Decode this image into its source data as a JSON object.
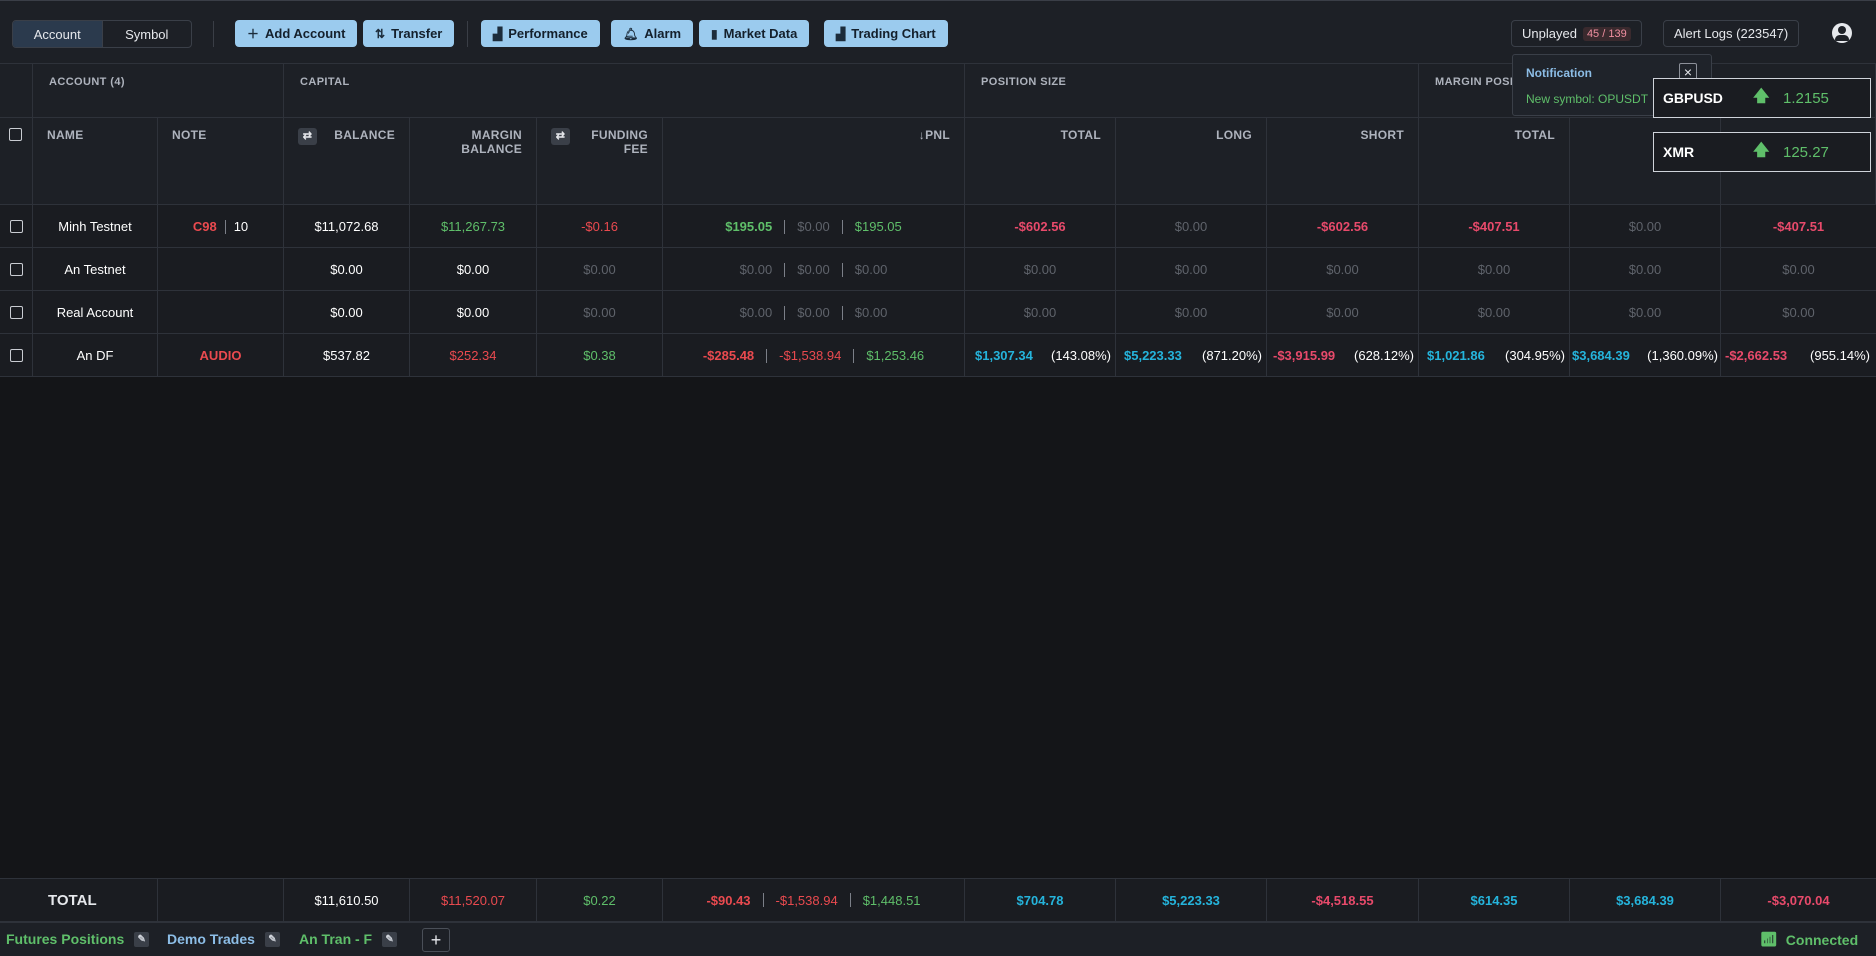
{
  "toolbar": {
    "view_tabs": [
      "Account",
      "Symbol"
    ],
    "add_account": "Add Account",
    "transfer": "Transfer",
    "performance": "Performance",
    "alarm": "Alarm",
    "market_data": "Market Data",
    "trading_chart": "Trading Chart",
    "unplayed_label": "Unplayed",
    "unplayed_count": "45 / 139",
    "alert_logs": "Alert Logs (223547)"
  },
  "groups": {
    "account": "ACCOUNT (4)",
    "capital": "CAPITAL",
    "position_size": "POSITION SIZE",
    "margin_pos": "MARGIN POSI"
  },
  "columns": {
    "name": "NAME",
    "note": "NOTE",
    "balance": "BALANCE",
    "margin_balance_1": "MARGIN",
    "margin_balance_2": "BALANCE",
    "funding_fee_1": "FUNDING",
    "funding_fee_2": "FEE",
    "pnl": "PNL",
    "ps_total": "TOTAL",
    "ps_long": "LONG",
    "ps_short": "SHORT",
    "mp_total": "TOTAL"
  },
  "rows": [
    {
      "name": "Minh Testnet",
      "note_tag": "C98",
      "note_num": "10",
      "balance": "$11,072.68",
      "margin_balance": "$11,267.73",
      "funding_fee": "-$0.16",
      "pnl": "$195.05",
      "pnl_a": "$0.00",
      "pnl_b": "$195.05",
      "ps_total": "-$602.56",
      "ps_long": "$0.00",
      "ps_short": "-$602.56",
      "mp_total": "-$407.51",
      "mp_long": "$0.00",
      "mp_short": "-$407.51"
    },
    {
      "name": "An Testnet",
      "note_tag": "",
      "note_num": "",
      "balance": "$0.00",
      "margin_balance": "$0.00",
      "funding_fee": "$0.00",
      "pnl": "$0.00",
      "pnl_a": "$0.00",
      "pnl_b": "$0.00",
      "ps_total": "$0.00",
      "ps_long": "$0.00",
      "ps_short": "$0.00",
      "mp_total": "$0.00",
      "mp_long": "$0.00",
      "mp_short": "$0.00"
    },
    {
      "name": "Real Account",
      "note_tag": "",
      "note_num": "",
      "balance": "$0.00",
      "margin_balance": "$0.00",
      "funding_fee": "$0.00",
      "pnl": "$0.00",
      "pnl_a": "$0.00",
      "pnl_b": "$0.00",
      "ps_total": "$0.00",
      "ps_long": "$0.00",
      "ps_short": "$0.00",
      "mp_total": "$0.00",
      "mp_long": "$0.00",
      "mp_short": "$0.00"
    },
    {
      "name": "An DF",
      "note_tag": "AUDIO",
      "note_num": "",
      "balance": "$537.82",
      "margin_balance": "$252.34",
      "funding_fee": "$0.38",
      "pnl": "-$285.48",
      "pnl_a": "-$1,538.94",
      "pnl_b": "$1,253.46",
      "ps_total": "$1,307.34",
      "ps_total_pct": "(143.08%)",
      "ps_long": "$5,223.33",
      "ps_long_pct": "(871.20%)",
      "ps_short": "-$3,915.99",
      "ps_short_pct": "(628.12%)",
      "mp_total": "$1,021.86",
      "mp_total_pct": "(304.95%)",
      "mp_long": "$3,684.39",
      "mp_long_pct": "(1,360.09%)",
      "mp_short": "-$2,662.53",
      "mp_short_pct": "(955.14%)"
    }
  ],
  "total": {
    "label": "TOTAL",
    "balance": "$11,610.50",
    "margin_balance": "$11,520.07",
    "funding_fee": "$0.22",
    "pnl": "-$90.43",
    "pnl_a": "-$1,538.94",
    "pnl_b": "$1,448.51",
    "ps_total": "$704.78",
    "ps_long": "$5,223.33",
    "ps_short": "-$4,518.55",
    "mp_total": "$614.35",
    "mp_long": "$3,684.39",
    "mp_short": "-$3,070.04"
  },
  "notification": {
    "title": "Notification",
    "message": "New symbol: OPUSDT"
  },
  "tickers": [
    {
      "symbol": "GBPUSD",
      "price": "1.2155"
    },
    {
      "symbol": "XMR",
      "price": "125.27"
    }
  ],
  "tabs": [
    "Futures Positions",
    "Demo Trades",
    "An Tran - F"
  ],
  "status": "Connected"
}
